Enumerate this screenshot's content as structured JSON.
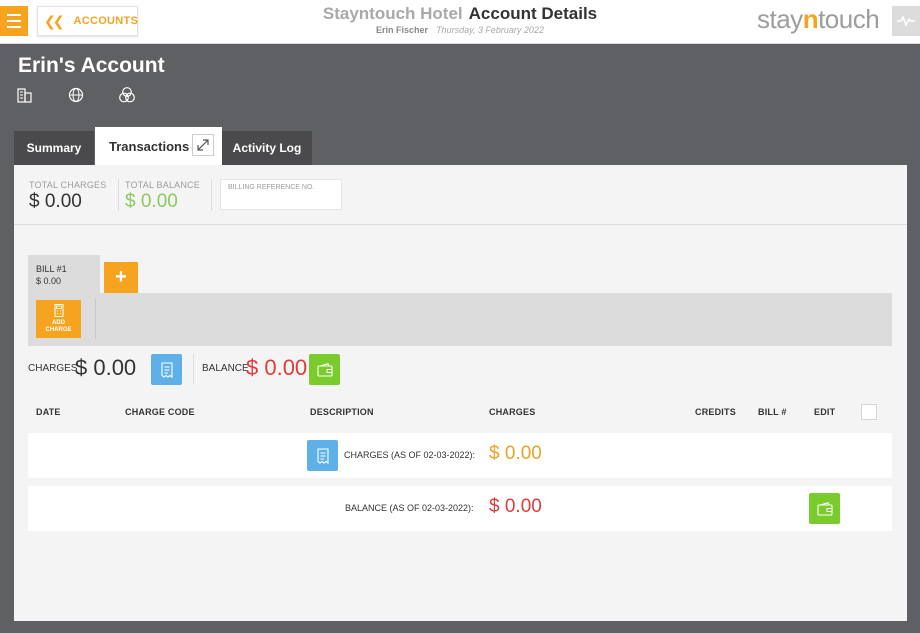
{
  "header": {
    "hotel_name": "Stayntouch Hotel",
    "page_title": "Account Details",
    "user_name": "Erin Fischer",
    "date": "Thursday, 3 February 2022",
    "back_label": "ACCOUNTS",
    "logo_prefix": "stay",
    "logo_accent": "n",
    "logo_suffix": "touch"
  },
  "account": {
    "title": "Erin's Account",
    "icons": [
      "building-icon",
      "globe-icon",
      "circles-icon"
    ]
  },
  "tabs": [
    {
      "label": "Summary",
      "active": false
    },
    {
      "label": "Transactions",
      "active": true
    },
    {
      "label": "Activity Log",
      "active": false
    }
  ],
  "summary": {
    "total_charges_label": "TOTAL CHARGES",
    "total_charges_value": "$ 0.00",
    "total_balance_label": "TOTAL BALANCE",
    "total_balance_value": "$ 0.00",
    "billing_ref_placeholder": "BILLING REFERENCE NO."
  },
  "bill": {
    "name": "BILL #1",
    "amount": "$ 0.00",
    "add_label": "+",
    "add_charge_line1": "ADD",
    "add_charge_line2": "CHARGE"
  },
  "totals": {
    "charges_label": "CHARGES",
    "charges_value": "$ 0.00",
    "balance_label": "BALANCE",
    "balance_value": "$ 0.00"
  },
  "table": {
    "columns": [
      "DATE",
      "CHARGE CODE",
      "DESCRIPTION",
      "CHARGES",
      "CREDITS",
      "BILL #",
      "EDIT"
    ],
    "charges_row_label": "CHARGES (AS OF 02-03-2022):",
    "charges_row_value": "$ 0.00",
    "balance_row_label": "BALANCE (AS OF 02-03-2022):",
    "balance_row_value": "$ 0.00"
  },
  "colors": {
    "accent_orange": "#f6a41f",
    "balance_red": "#e03b3b",
    "charges_orange": "#f2a024",
    "positive_green": "#8cc95f",
    "button_blue": "#5fb0e8",
    "button_green": "#7acc2d"
  }
}
